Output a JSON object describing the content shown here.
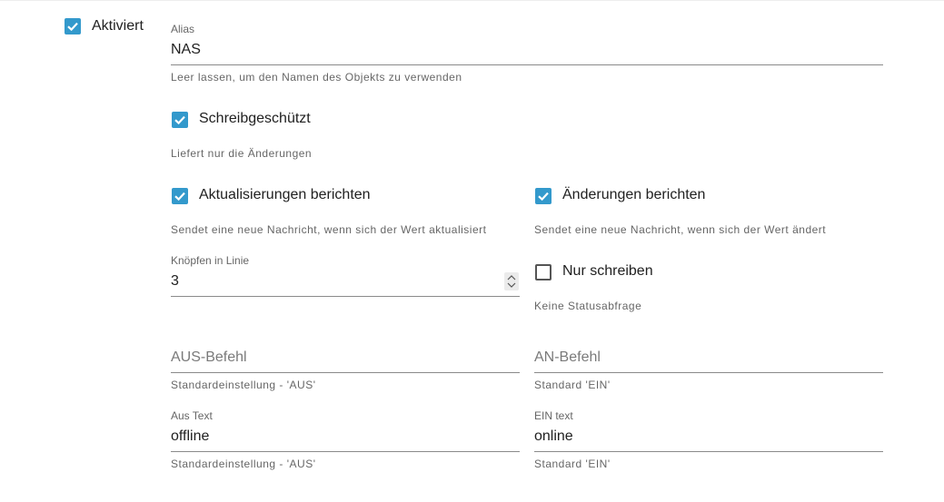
{
  "enabled": {
    "label": "Aktiviert",
    "checked": true
  },
  "alias": {
    "label": "Alias",
    "value": "NAS",
    "helper": "Leer lassen, um den Namen des Objekts zu verwenden"
  },
  "readonly": {
    "label": "Schreibgeschützt",
    "checked": true,
    "helper": "Liefert nur die Änderungen"
  },
  "report_updates": {
    "label": "Aktualisierungen berichten",
    "checked": true,
    "helper": "Sendet eine neue Nachricht, wenn sich der Wert aktualisiert"
  },
  "report_changes": {
    "label": "Änderungen berichten",
    "checked": true,
    "helper": "Sendet eine neue Nachricht, wenn sich der Wert ändert"
  },
  "buttons_in_line": {
    "label": "Knöpfen in Linie",
    "value": "3"
  },
  "write_only": {
    "label": "Nur schreiben",
    "checked": false,
    "helper": "Keine Statusabfrage"
  },
  "off_command": {
    "placeholder": "AUS-Befehl",
    "helper": "Standardeinstellung - 'AUS'"
  },
  "on_command": {
    "placeholder": "AN-Befehl",
    "helper": "Standard 'EIN'"
  },
  "off_text": {
    "label": "Aus Text",
    "value": "offline",
    "helper": "Standardeinstellung - 'AUS'"
  },
  "on_text": {
    "label": "EIN text",
    "value": "online",
    "helper": "Standard 'EIN'"
  },
  "colors": {
    "checkbox": "#3399cc",
    "underline": "#8a8a8a",
    "helper": "#666666"
  }
}
